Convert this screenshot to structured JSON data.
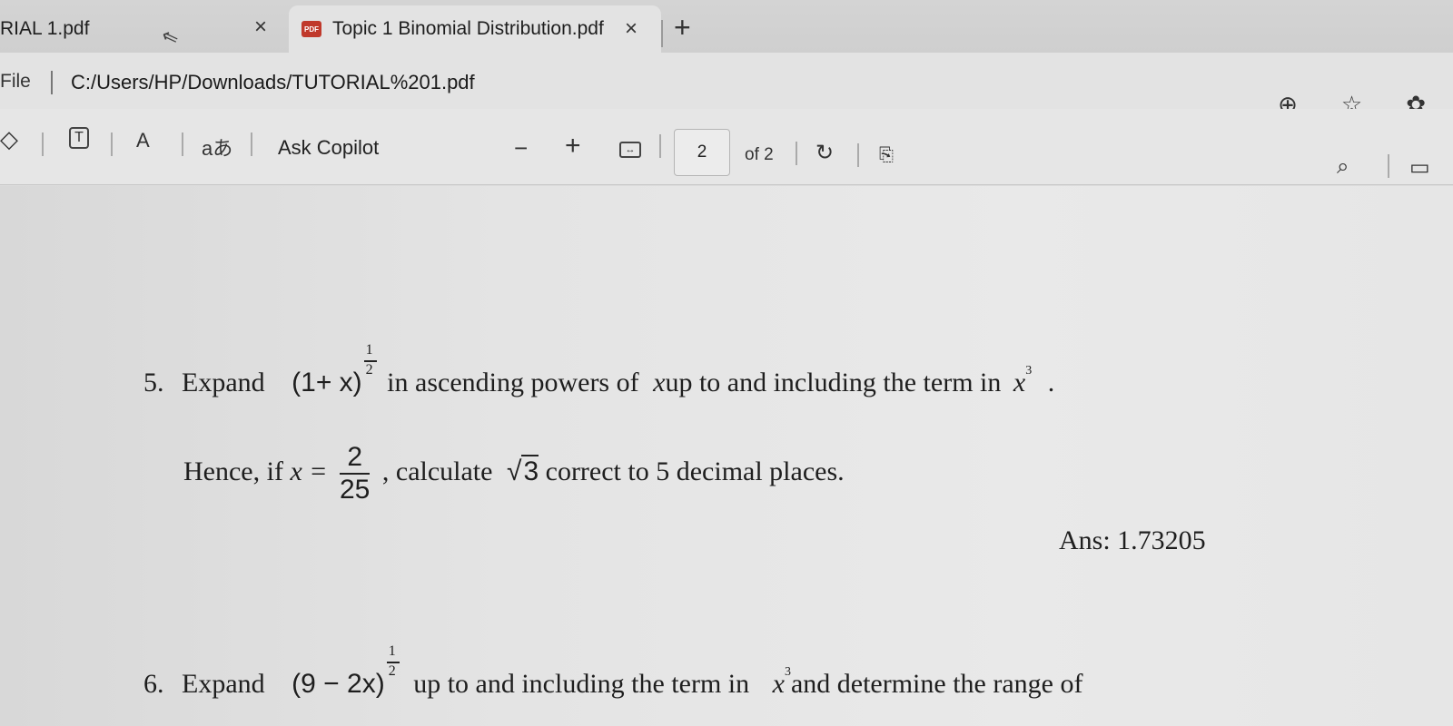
{
  "tabs": [
    {
      "title": "RIAL 1.pdf",
      "active": false
    },
    {
      "title": "Topic 1 Binomial Distribution.pdf",
      "active": true,
      "icon": "pdf-icon"
    }
  ],
  "icons": {
    "close": "×",
    "new_tab": "+",
    "pdf_badge": "PDF"
  },
  "address": {
    "scheme_label": "File",
    "url": "C:/Users/HP/Downloads/TUTORIAL%201.pdf"
  },
  "toolbar": {
    "copilot_label": "Ask Copilot",
    "zoom_out": "−",
    "zoom_in": "+",
    "current_page": "2",
    "page_count": "of 2",
    "read_aloud": "A",
    "translate": "aあ"
  },
  "document": {
    "q5_number": "5.",
    "q5_expand": "Expand",
    "q5_expr_base": "(1+ x)",
    "q5_exp_num": "1",
    "q5_exp_den": "2",
    "q5_text": "in ascending powers of",
    "q5_var": "x",
    "q5_text2": "up to and including the term in",
    "q5_term": "x",
    "q5_term_exp": "3",
    "q5_end": ".",
    "q5_hence": "Hence, if",
    "q5_x_eq": "x =",
    "q5_frac_num": "2",
    "q5_frac_den": "25",
    "q5_calc": ", calculate",
    "q5_sqrt_sym": "√",
    "q5_sqrt_val": "3",
    "q5_correct": "correct to 5 decimal places.",
    "q5_answer": "Ans: 1.73205",
    "q6_number": "6.",
    "q6_expand": "Expand",
    "q6_expr_base": "(9 − 2x)",
    "q6_exp_num": "1",
    "q6_exp_den": "2",
    "q6_text": "up to and including the term in",
    "q6_term": "x",
    "q6_term_exp": "3",
    "q6_text2": "and determine the range of"
  }
}
